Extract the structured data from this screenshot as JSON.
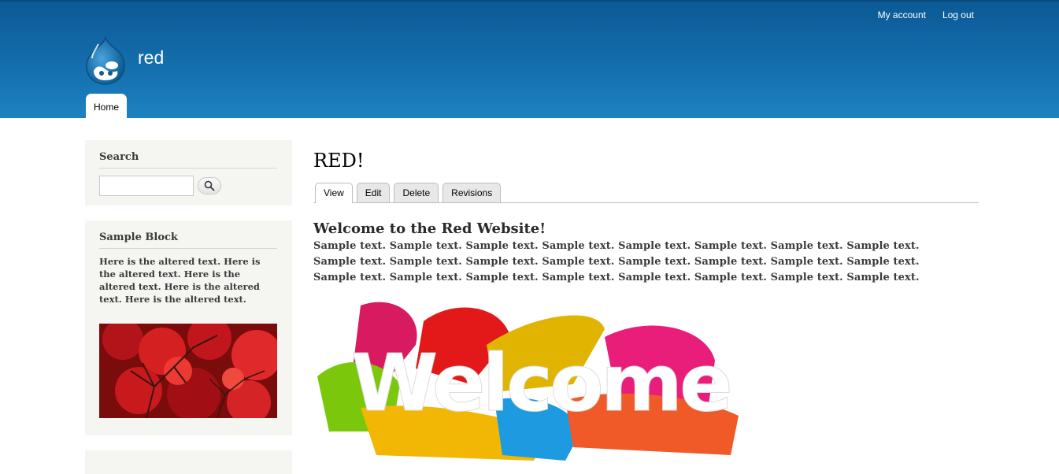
{
  "header": {
    "site_name": "red",
    "secondary_menu": [
      "My account",
      "Log out"
    ],
    "main_menu": [
      "Home"
    ],
    "colors": {
      "bar_top": "#0a5a96",
      "bar_bottom": "#1d82c2"
    }
  },
  "sidebar": {
    "search": {
      "title": "Search",
      "input_value": "",
      "button_icon": "magnifier-icon"
    },
    "sample_block": {
      "title": "Sample Block",
      "text": "Here is the altered text. Here is the altered text. Here is the altered text. Here is the altered text. Here is the altered text."
    }
  },
  "main": {
    "page_title": "RED!",
    "tabs": [
      "View",
      "Edit",
      "Delete",
      "Revisions"
    ],
    "active_tab": "View",
    "article": {
      "heading": "Welcome to the Red Website!",
      "body": "Sample text. Sample text. Sample text. Sample text. Sample text. Sample text. Sample text. Sample text. Sample text. Sample text. Sample text. Sample text. Sample text. Sample text. Sample text. Sample text. Sample text. Sample text. Sample text. Sample text. Sample text. Sample text. Sample text. Sample text.",
      "image_text": "Welcome"
    }
  }
}
